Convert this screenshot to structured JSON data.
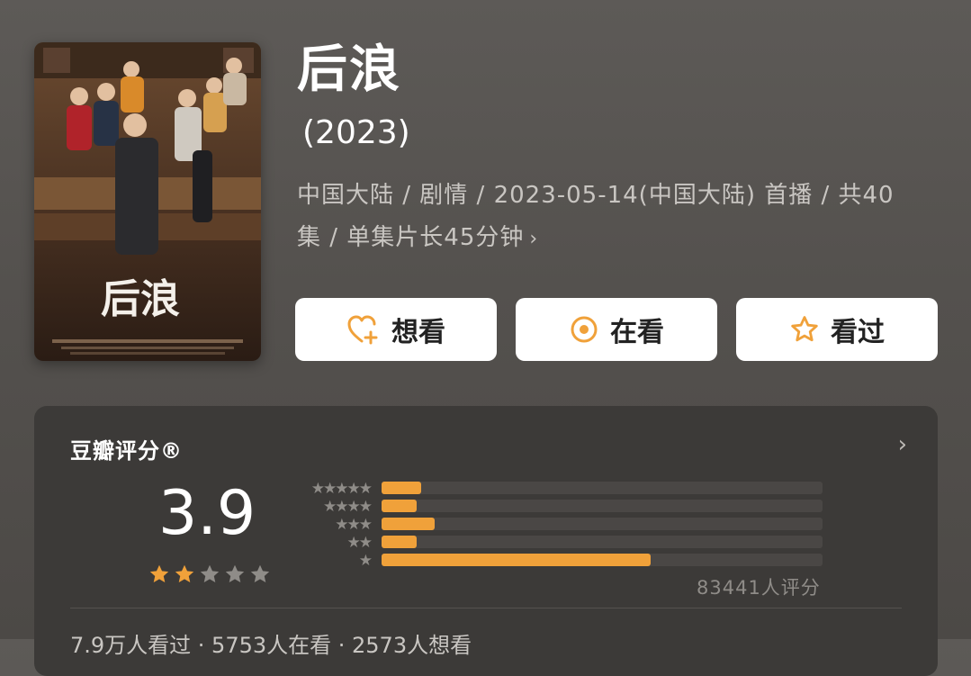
{
  "show": {
    "title": "后浪",
    "year": "(2023)",
    "meta_line1": "中国大陆 / 剧情 / 2023-05-14(中国大陆) 首播 / 共40",
    "meta_line2": "集 / 单集片长45分钟",
    "meta_chevron": "›",
    "poster_title": "后浪"
  },
  "actions": {
    "want_label": "想看",
    "watching_label": "在看",
    "watched_label": "看过"
  },
  "rating": {
    "header": "豆瓣评分®",
    "header_chevron": "›",
    "score": "3.9",
    "stars_filled": 2,
    "stars_total": 5,
    "rating_count": "83441人评分",
    "distribution": [
      {
        "stars": 5,
        "label": "★★★★★",
        "fraction": 0.09
      },
      {
        "stars": 4,
        "label": "★★★★",
        "fraction": 0.08
      },
      {
        "stars": 3,
        "label": "★★★",
        "fraction": 0.12
      },
      {
        "stars": 2,
        "label": "★★",
        "fraction": 0.08
      },
      {
        "stars": 1,
        "label": "★",
        "fraction": 0.61
      }
    ],
    "stats_line": "7.9万人看过 · 5753人在看 · 2573人想看"
  },
  "colors": {
    "accent": "#f0a13a",
    "star_empty": "#8f8c88"
  },
  "icons": {
    "want": "heart-plus-icon",
    "watching": "target-icon",
    "watched": "star-outline-icon"
  }
}
